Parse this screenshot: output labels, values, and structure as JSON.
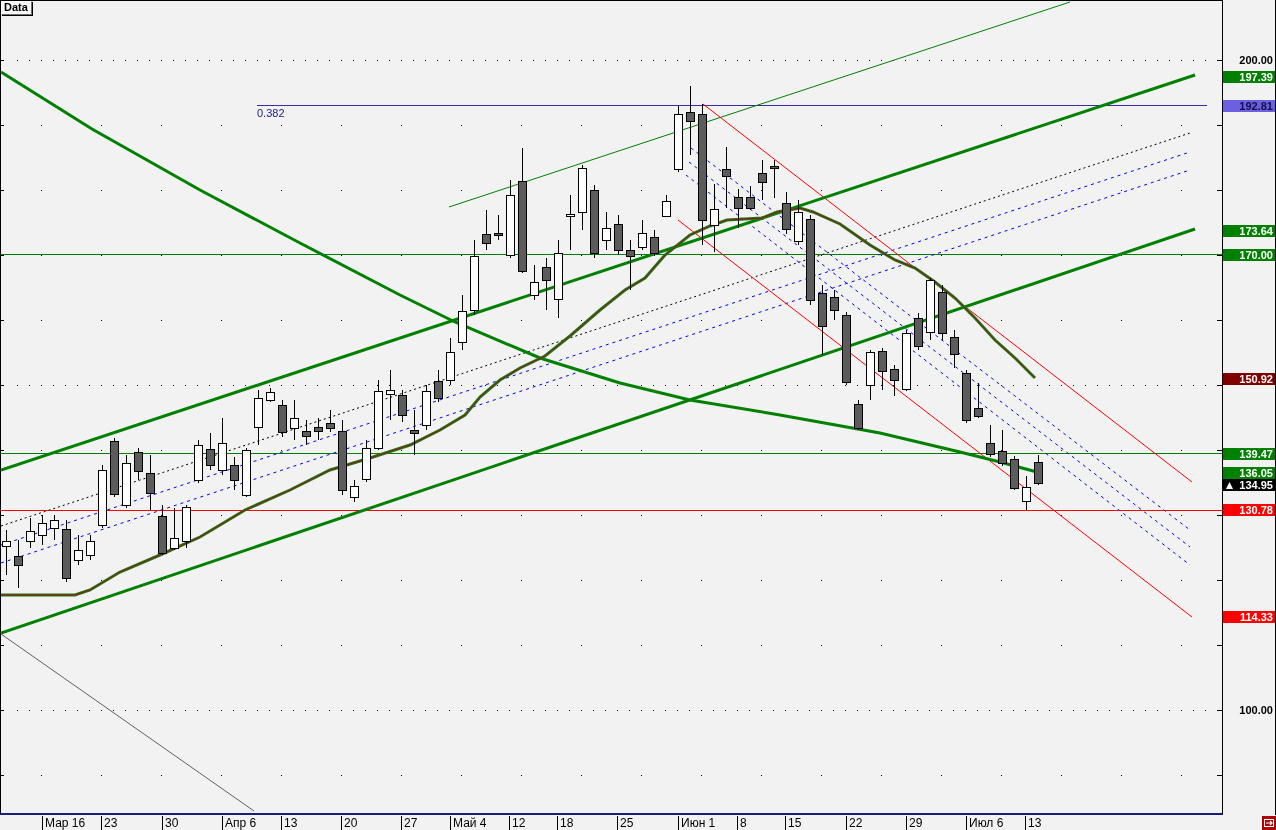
{
  "toolbar": {
    "data_button": "Data"
  },
  "chart": {
    "fib_level_label": "0.382",
    "axis_labels": [
      "200.00",
      "100.00"
    ],
    "price_labels": [
      {
        "text": "197.39",
        "kind": "light",
        "color": "#008000"
      },
      {
        "text": "192.81",
        "kind": "dark",
        "color": "#6a60e0"
      },
      {
        "text": "173.64",
        "kind": "light",
        "color": "#008000"
      },
      {
        "text": "170.00",
        "kind": "light",
        "color": "#008000"
      },
      {
        "text": "150.92",
        "kind": "light",
        "color": "#800000"
      },
      {
        "text": "139.47",
        "kind": "light",
        "color": "#008000"
      },
      {
        "text": "136.05",
        "kind": "light",
        "color": "#008000"
      },
      {
        "text": "134.95",
        "kind": "last",
        "color": "#000000"
      },
      {
        "text": "130.78",
        "kind": "light",
        "color": "#ff0000"
      },
      {
        "text": "114.33",
        "kind": "light",
        "color": "#ff0000"
      }
    ],
    "date_labels": [
      "Мар 16",
      "23",
      "30",
      "Апр 6",
      "13",
      "20",
      "27",
      "Май 4",
      "12",
      "18",
      "25",
      "Июн 1",
      "8",
      "15",
      "22",
      "29",
      "Июл 6",
      "13"
    ]
  }
}
